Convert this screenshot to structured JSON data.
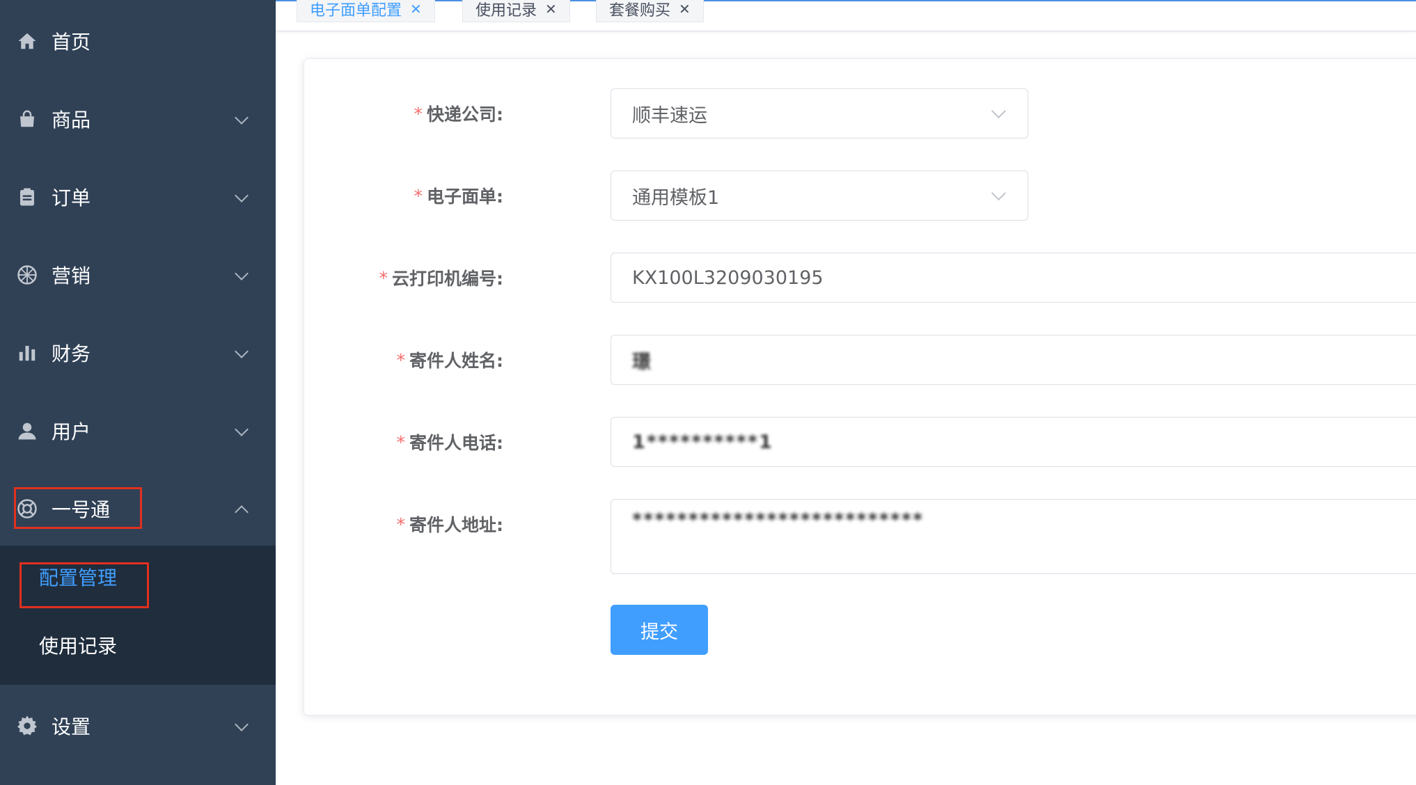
{
  "sidebar": {
    "items": [
      {
        "label": "首页",
        "icon": "home-icon"
      },
      {
        "label": "商品",
        "icon": "shopping-bag-icon"
      },
      {
        "label": "订单",
        "icon": "clipboard-icon"
      },
      {
        "label": "营销",
        "icon": "aperture-icon"
      },
      {
        "label": "财务",
        "icon": "bar-chart-icon"
      },
      {
        "label": "用户",
        "icon": "user-icon"
      },
      {
        "label": "一号通",
        "icon": "lifebuoy-icon"
      },
      {
        "label": "设置",
        "icon": "gear-icon"
      }
    ],
    "submenu": [
      {
        "label": "配置管理",
        "active": true
      },
      {
        "label": "使用记录",
        "active": false
      }
    ]
  },
  "tags": [
    {
      "label": "电子面单配置",
      "active": true
    },
    {
      "label": "使用记录",
      "active": false
    },
    {
      "label": "套餐购买",
      "active": false
    }
  ],
  "form": {
    "courier": {
      "label": "快递公司:",
      "value": "顺丰速运"
    },
    "waybill": {
      "label": "电子面单:",
      "value": "通用模板1"
    },
    "printer": {
      "label": "云打印机编号:",
      "value": "KX100L3209030195"
    },
    "sender_name": {
      "label": "寄件人姓名:",
      "value": "璟"
    },
    "sender_phone": {
      "label": "寄件人电话:",
      "value": "1**********1"
    },
    "sender_address": {
      "label": "寄件人地址:",
      "value": "**************************"
    },
    "required_mark": "*",
    "submit_label": "提交"
  },
  "colors": {
    "sidebar_bg": "#304156",
    "submenu_bg": "#1f2d3d",
    "accent": "#409eff",
    "highlight_box": "#e1301e",
    "required": "#f56c6c"
  }
}
